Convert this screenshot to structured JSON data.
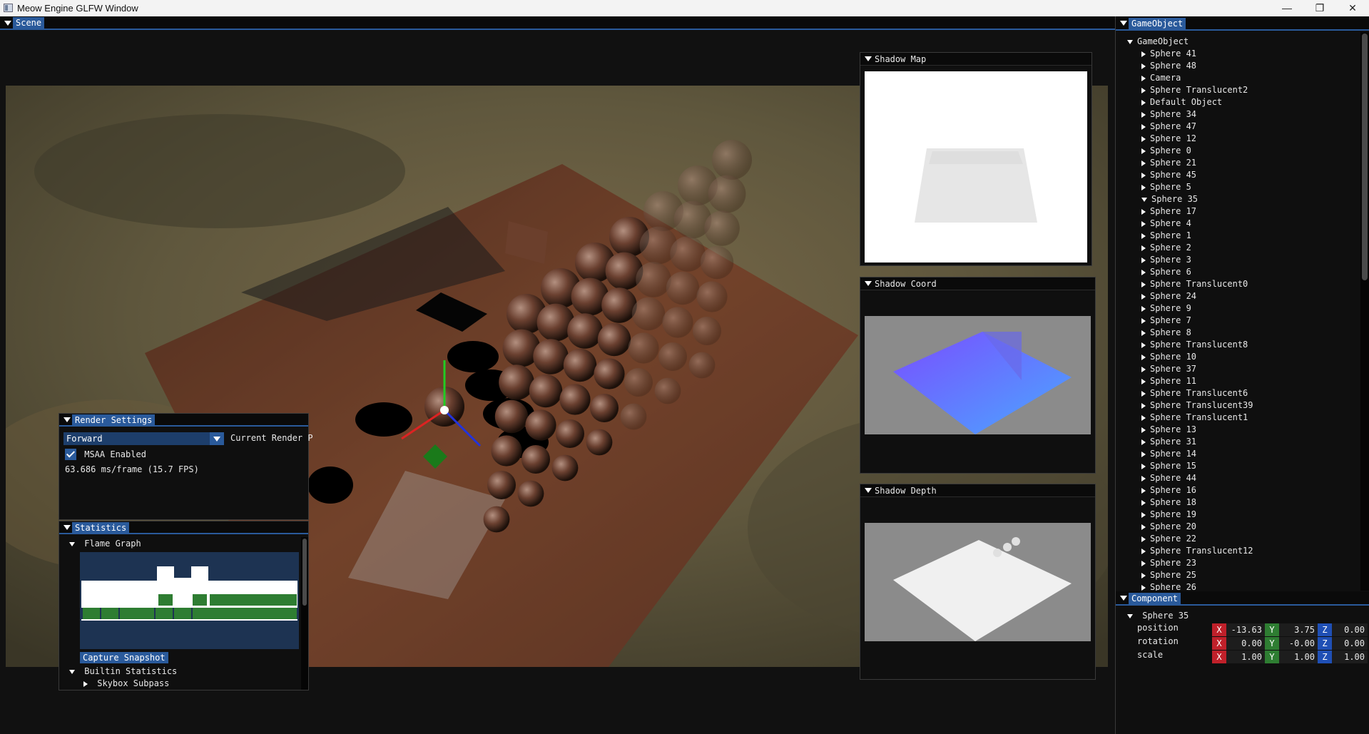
{
  "window": {
    "title": "Meow Engine GLFW Window",
    "controls": [
      "—",
      "❐",
      "✕"
    ]
  },
  "scene": {
    "tab": "Scene"
  },
  "shadow_map": {
    "title": "Shadow Map"
  },
  "shadow_coord": {
    "title": "Shadow Coord"
  },
  "shadow_depth": {
    "title": "Shadow Depth"
  },
  "render_settings": {
    "title": "Render Settings",
    "mode_value": "Forward",
    "mode_label": "Current Render P",
    "msaa_label": "MSAA Enabled",
    "frame_time": "63.686 ms/frame (15.7 FPS)"
  },
  "statistics": {
    "title": "Statistics",
    "flame_graph_label": "Flame Graph",
    "capture_button": "Capture Snapshot",
    "builtin_label": "Builtin Statistics",
    "skybox_label": "Skybox Subpass"
  },
  "gameobject": {
    "tab": "GameObject",
    "root": "GameObject",
    "items": [
      "Sphere 41",
      "Sphere 48",
      "Camera",
      "Sphere Translucent2",
      "Default Object",
      "Sphere 34",
      "Sphere 47",
      "Sphere 12",
      "Sphere 0",
      "Sphere 21",
      "Sphere 45",
      "Sphere 5",
      "Sphere 35",
      "Sphere 17",
      "Sphere 4",
      "Sphere 1",
      "Sphere 2",
      "Sphere 3",
      "Sphere 6",
      "Sphere Translucent0",
      "Sphere 24",
      "Sphere 9",
      "Sphere 7",
      "Sphere 8",
      "Sphere Translucent8",
      "Sphere 10",
      "Sphere 37",
      "Sphere 11",
      "Sphere Translucent6",
      "Sphere Translucent39",
      "Sphere Translucent1",
      "Sphere 13",
      "Sphere 31",
      "Sphere 14",
      "Sphere 15",
      "Sphere 44",
      "Sphere 16",
      "Sphere 18",
      "Sphere 19",
      "Sphere 20",
      "Sphere 22",
      "Sphere Translucent12",
      "Sphere 23",
      "Sphere 25",
      "Sphere 26"
    ],
    "expanded_item": "Sphere 35"
  },
  "component": {
    "tab": "Component",
    "object": "Sphere 35",
    "rows": [
      {
        "label": "position",
        "x": "-13.63",
        "y": "3.75",
        "z": "0.00"
      },
      {
        "label": "rotation",
        "x": "0.00",
        "y": "-0.00",
        "z": "0.00"
      },
      {
        "label": "scale",
        "x": "1.00",
        "y": "1.00",
        "z": "1.00"
      }
    ],
    "axis_x": "X",
    "axis_y": "Y",
    "axis_z": "Z",
    "colors": {
      "x": "#c0202a",
      "y": "#2e7d32",
      "z": "#1f4fb5"
    }
  }
}
